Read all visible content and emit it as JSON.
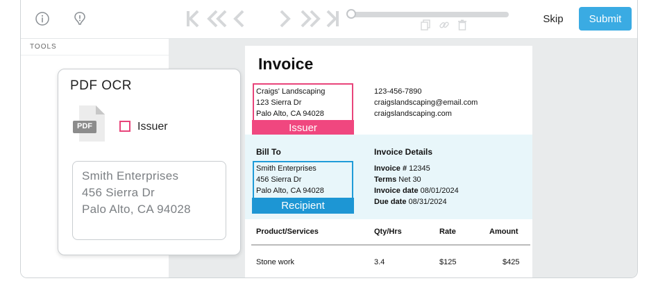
{
  "toolbar": {
    "skip_label": "Skip",
    "submit_label": "Submit",
    "submit_color": "#3aabe3",
    "icons": [
      "info-icon",
      "hint-icon",
      "first-page-icon",
      "rewind-icon",
      "prev-icon",
      "next-icon",
      "fast-forward-icon",
      "last-page-icon",
      "copy-icon",
      "link-icon",
      "delete-icon"
    ],
    "progress_fraction": 0
  },
  "sidebar": {
    "tools_label": "TOOLS"
  },
  "ocr_panel": {
    "title": "PDF OCR",
    "pdf_icon_text": "PDF",
    "checkbox_label": "Issuer",
    "extracted_lines": [
      "Smith Enterprises",
      "456 Sierra Dr",
      "Palo Alto, CA 94028"
    ]
  },
  "invoice": {
    "title": "Invoice",
    "issuer_lines": [
      "Craigs' Landscaping",
      "123 Sierra Dr",
      "Palo Alto, CA 94028"
    ],
    "contact_lines": [
      "123-456-7890",
      "craigslandscaping@email.com",
      "craigslandscaping.com"
    ],
    "issuer_tag": "Issuer",
    "bill_to_heading": "Bill To",
    "recipient_lines": [
      "Smith Enterprises",
      "456 Sierra Dr",
      "Palo Alto, CA 94028"
    ],
    "recipient_tag": "Recipient",
    "details_heading": "Invoice Details",
    "details": [
      {
        "label": "Invoice #",
        "value": "12345"
      },
      {
        "label": "Terms",
        "value": "Net 30"
      },
      {
        "label": "Invoice date",
        "value": "08/01/2024"
      },
      {
        "label": "Due date",
        "value": "08/31/2024"
      }
    ],
    "table_headers": [
      "Product/Services",
      "Qty/Hrs",
      "Rate",
      "Amount"
    ],
    "rows": [
      [
        "Stone work",
        "3.4",
        "$125",
        "$425"
      ]
    ],
    "issuer_color": "#f0477f",
    "recipient_color": "#1d96d4"
  }
}
